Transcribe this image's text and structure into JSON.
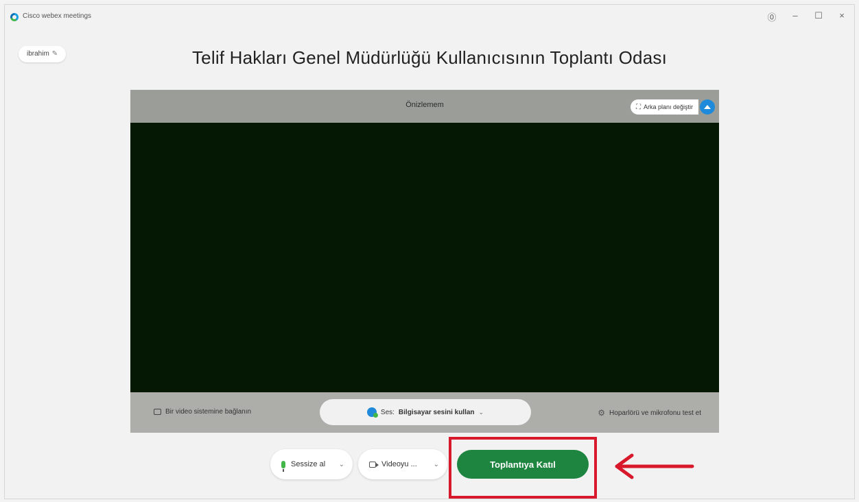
{
  "window": {
    "app_title": "Cisco webex meetings",
    "controls": {
      "help": "⓪",
      "minimize": "–",
      "maximize": "☐",
      "close": "×"
    }
  },
  "user": {
    "name": "ibrahim",
    "edit_icon": "pencil-icon"
  },
  "room_title": "Telif Hakları Genel Müdürlüğü Kullanıcısının Toplantı Odası",
  "preview": {
    "label": "Önizlemem",
    "background_button": "Arka planı değiştir",
    "footer": {
      "video_system": "Bir video sistemine bağlanın",
      "audio_label": "Ses:",
      "audio_value": "Bilgisayar sesini kullan",
      "speaker_test": "Hoparlörü ve mikrofonu test et"
    }
  },
  "controls": {
    "mute_label": "Sessize al",
    "video_label": "Videoyu ...",
    "join_label": "Toplantıya Katıl"
  },
  "colors": {
    "join_green": "#1e8540",
    "highlight_red": "#d8182b",
    "video_bg": "#051804",
    "accent_blue": "#1f8ad9"
  }
}
